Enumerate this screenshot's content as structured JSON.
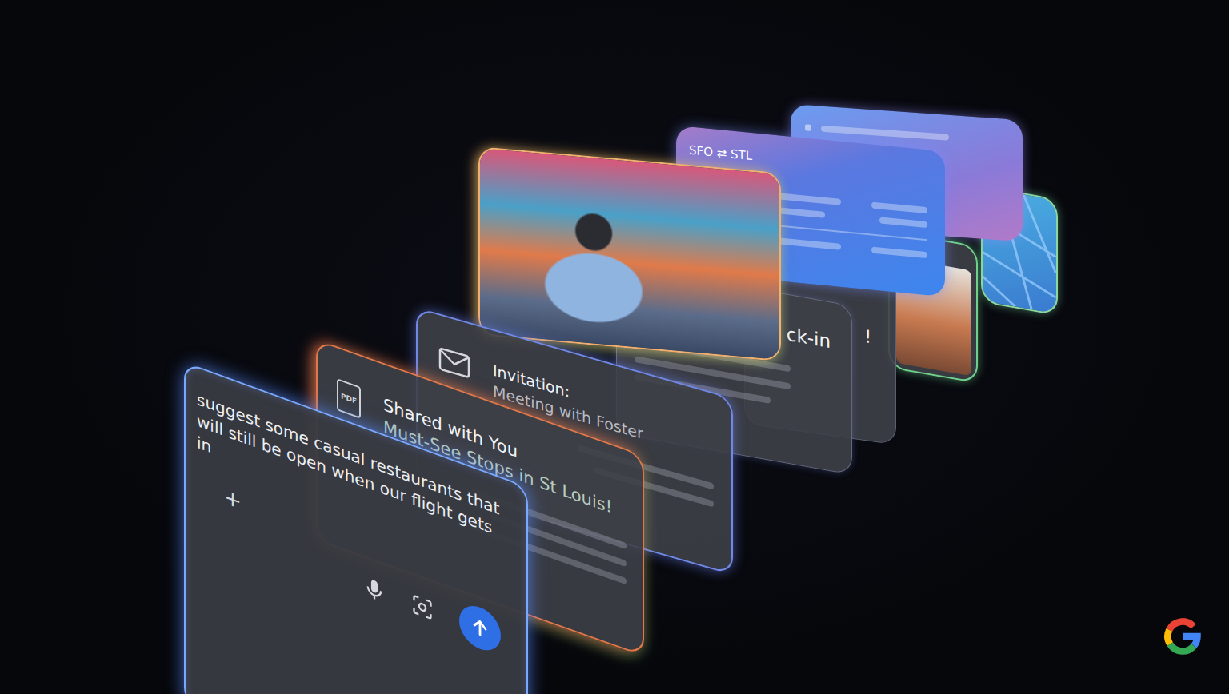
{
  "composer": {
    "text": "suggest some casual restaurants that will still be open when our flight gets in",
    "add_label": "+"
  },
  "shared_card": {
    "badge": "PDF",
    "title": "Shared with You",
    "subtitle": "Must-See Stops in St Louis!"
  },
  "invitation_card": {
    "title": "Invitation:",
    "subtitle": "Meeting with Foster"
  },
  "checkin_card": {
    "title": "ck-in"
  },
  "note_card": {
    "title": "!"
  },
  "flight_card": {
    "route": "SFO ⇄ STL"
  }
}
